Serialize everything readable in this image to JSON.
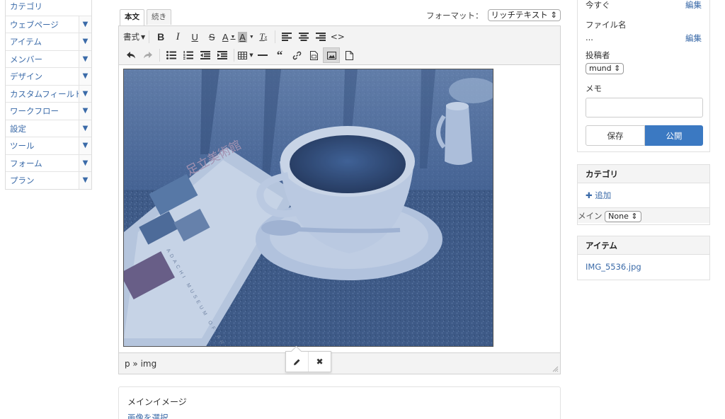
{
  "sidebar": {
    "items": [
      {
        "label": "カテゴリ",
        "has_arrow": false
      },
      {
        "label": "ウェブページ",
        "has_arrow": true
      },
      {
        "label": "アイテム",
        "has_arrow": true
      },
      {
        "label": "メンバー",
        "has_arrow": true
      },
      {
        "label": "デザイン",
        "has_arrow": true
      },
      {
        "label": "カスタムフィールド",
        "has_arrow": true
      },
      {
        "label": "ワークフロー",
        "has_arrow": true
      },
      {
        "label": "設定",
        "has_arrow": true
      },
      {
        "label": "ツール",
        "has_arrow": true
      },
      {
        "label": "フォーム",
        "has_arrow": true
      },
      {
        "label": "プラン",
        "has_arrow": true
      }
    ],
    "arrow_glyph": "▼"
  },
  "editor": {
    "tabs": [
      "本文",
      "続き"
    ],
    "format_label": "フォーマット：",
    "format_value": "リッチテキスト",
    "format_label_text": "書式",
    "path": "p » img",
    "photo_book_title": "足立美術館",
    "photo_book_spine_text": "ADACHI MUSEUM OF ART"
  },
  "main_image": {
    "title": "メインイメージ",
    "select_link": "画像を選択"
  },
  "publish": {
    "timing_value": "今すぐ",
    "edit_link": "編集",
    "filename_label": "ファイル名",
    "filename_value": "...",
    "author_label": "投稿者",
    "author_value": "mund",
    "memo_label": "メモ",
    "save_label": "保存",
    "publish_label": "公開"
  },
  "category_panel": {
    "title": "カテゴリ",
    "add_label": "追加",
    "main_label": "メイン",
    "main_value": "None"
  },
  "items_panel": {
    "title": "アイテム",
    "file": "IMG_5536.jpg"
  },
  "colors": {
    "link": "#3a6aa8",
    "primary": "#3b79c2",
    "photo_tint": "#4a6ea8"
  }
}
